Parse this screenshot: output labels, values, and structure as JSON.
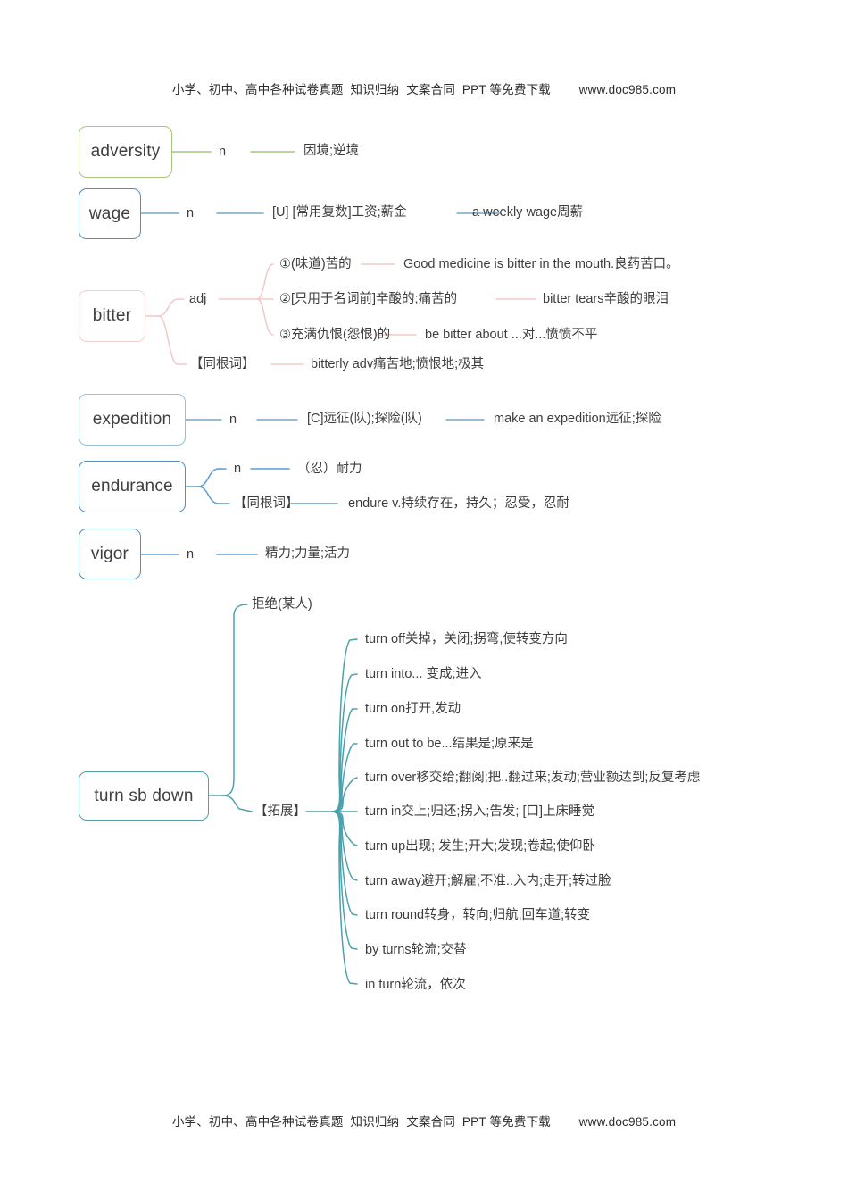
{
  "banner": {
    "text": "小学、初中、高中各种试卷真题  知识归纳  文案合同  PPT 等免费下载        www.doc985.com"
  },
  "colors": {
    "green": "#a4c77f",
    "blue": "#4f8fc0",
    "pink": "#f6cfcf",
    "light_teal": "#93c3d6",
    "teal": "#4ba2ae",
    "text": "#3d3d3d",
    "background": "#ffffff"
  },
  "entries": {
    "adversity": {
      "word": "adversity",
      "pos": "n",
      "meaning": "因境;逆境"
    },
    "wage": {
      "word": "wage",
      "pos": "n",
      "meaning": "[U] [常用复数]工资;薪金",
      "example": "a weekly wage周薪"
    },
    "bitter": {
      "word": "bitter",
      "pos": "adj",
      "senses": [
        {
          "meaning": "①(味道)苦的",
          "example": "Good medicine is bitter in the mouth.良药苦口。"
        },
        {
          "meaning": "②[只用于名词前]辛酸的;痛苦的",
          "example": "bitter tears辛酸的眼泪"
        },
        {
          "meaning": "③充满仇恨(怨恨)的",
          "example": "be bitter about ...对...愤愤不平"
        }
      ],
      "cognate_label": "【同根词】",
      "cognate": "bitterly adv痛苦地;愤恨地;极其"
    },
    "expedition": {
      "word": "expedition",
      "pos": "n",
      "meaning": "[C]远征(队);探险(队)",
      "example": "make an expedition远征;探险"
    },
    "endurance": {
      "word": "endurance",
      "pos": "n",
      "meaning": "（忍）耐力",
      "cognate_label": "【同根词】",
      "cognate": "endure v.持续存在，持久；忍受，忍耐"
    },
    "vigor": {
      "word": "vigor",
      "pos": "n",
      "meaning": "精力;力量;活力"
    },
    "turn_sb_down": {
      "word": "turn sb down",
      "meaning": "拒绝(某人)",
      "extension_label": "【拓展】",
      "phrases": [
        "turn off关掉，关闭;拐弯,使转变方向",
        "turn into... 变成;进入",
        "turn on打开,发动",
        "turn out to be...结果是;原来是",
        "turn over移交给;翻阅;把..翻过来;发动;营业额达到;反复考虑",
        "turn in交上;归还;拐入;告发; [口]上床睡觉",
        "turn up出现; 发生;开大;发现;卷起;使仰卧",
        "turn away避开;解雇;不准..入内;走开;转过脸",
        "turn round转身，转向;归航;回车道;转变",
        "by turns轮流;交替",
        "in turn轮流，依次"
      ]
    }
  }
}
